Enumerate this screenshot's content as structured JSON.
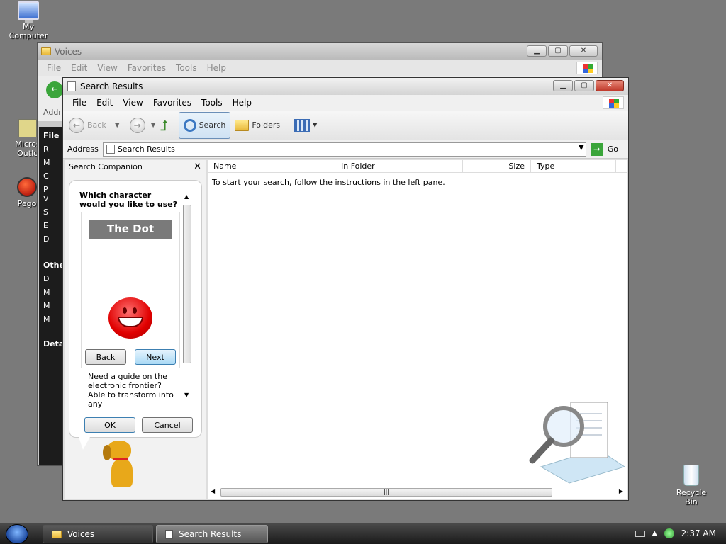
{
  "desktop": {
    "icons": [
      {
        "label": "My Computer"
      },
      {
        "label": "Recycle Bin"
      },
      {
        "label": "Microsoft Outlook",
        "partial_label_top": "Micros",
        "partial_label_bottom": "Outlo"
      },
      {
        "label": "Pego"
      }
    ]
  },
  "voices_window": {
    "title": "Voices",
    "menu": [
      "File",
      "Edit",
      "View",
      "Favorites",
      "Tools",
      "Help"
    ],
    "address_partial": "Addr",
    "side_items": [
      "File a",
      "R",
      "M",
      "C",
      "P",
      "V",
      "S",
      "E",
      "D",
      "Other",
      "D",
      "M",
      "M",
      "M",
      "Detai"
    ]
  },
  "search_window": {
    "title": "Search Results",
    "menu": [
      "File",
      "Edit",
      "View",
      "Favorites",
      "Tools",
      "Help"
    ],
    "toolbar": {
      "back": "Back",
      "search": "Search",
      "folders": "Folders"
    },
    "address": {
      "label": "Address",
      "value": "Search Results",
      "go": "Go"
    },
    "companion": {
      "title": "Search Companion",
      "question": "Which character would you like to use?",
      "character_name": "The Dot",
      "back_label": "Back",
      "next_label": "Next",
      "description": "Need a guide on the electronic frontier? Able to transform into any",
      "ok_label": "OK",
      "cancel_label": "Cancel"
    },
    "columns": [
      "Name",
      "In Folder",
      "Size",
      "Type"
    ],
    "empty_message": "To start your search, follow the instructions in the left pane."
  },
  "taskbar": {
    "buttons": [
      {
        "label": "Voices",
        "active": false
      },
      {
        "label": "Search Results",
        "active": true
      }
    ],
    "clock": "2:37 AM"
  }
}
